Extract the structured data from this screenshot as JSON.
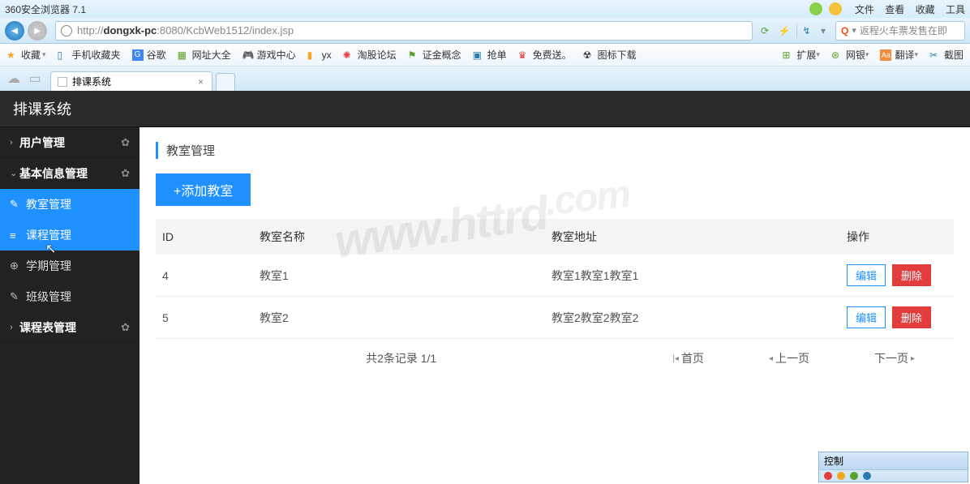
{
  "browser": {
    "title": "360安全浏览器 7.1",
    "menus": [
      "文件",
      "查看",
      "收藏",
      "工具"
    ],
    "url_prefix": "http://",
    "url_host": "dongxk-pc",
    "url_rest": ":8080/KcbWeb1512/index.jsp",
    "search_placeholder": "返程火车票发售在即",
    "bookmarks_left": [
      {
        "label": "收藏",
        "icon": "star"
      },
      {
        "label": "手机收藏夹",
        "icon": "phone"
      },
      {
        "label": "谷歌",
        "icon": "g"
      },
      {
        "label": "网址大全",
        "icon": "grid"
      },
      {
        "label": "游戏中心",
        "icon": "game"
      },
      {
        "label": "yx",
        "icon": "link"
      },
      {
        "label": "淘股论坛",
        "icon": "tao"
      },
      {
        "label": "证金概念",
        "icon": "flag"
      },
      {
        "label": "抢单",
        "icon": "bolt"
      },
      {
        "label": "免费送。",
        "icon": "gift"
      },
      {
        "label": "图标下载",
        "icon": "dl"
      }
    ],
    "bookmarks_right": [
      {
        "label": "扩展",
        "icon": "ext"
      },
      {
        "label": "网银",
        "icon": "bank"
      },
      {
        "label": "翻译",
        "icon": "trans"
      },
      {
        "label": "截图",
        "icon": "snip"
      }
    ],
    "tab_title": "排课系统",
    "control_panel": "控制"
  },
  "app": {
    "title": "排课系统",
    "sidebar": {
      "groups": [
        {
          "label": "用户管理",
          "chev": "›",
          "gear": true
        },
        {
          "label": "基本信息管理",
          "chev": "⌄",
          "gear": true,
          "items": [
            {
              "label": "教室管理",
              "icon": "✎",
              "state": "active"
            },
            {
              "label": "课程管理",
              "icon": "≡",
              "state": "current"
            },
            {
              "label": "学期管理",
              "icon": "⊕"
            },
            {
              "label": "班级管理",
              "icon": "✎"
            }
          ]
        },
        {
          "label": "课程表管理",
          "chev": "›",
          "gear": true
        }
      ]
    },
    "page": {
      "title": "教室管理",
      "add_button": "+添加教室",
      "columns": [
        "ID",
        "教室名称",
        "教室地址",
        "操作"
      ],
      "rows": [
        {
          "id": "4",
          "name": "教室1",
          "addr": "教室1教室1教室1"
        },
        {
          "id": "5",
          "name": "教室2",
          "addr": "教室2教室2教室2"
        }
      ],
      "edit_label": "编辑",
      "delete_label": "删除",
      "pager": {
        "info": "共2条记录 1/1",
        "first": "首页",
        "prev": "上一页",
        "next": "下一页"
      }
    }
  },
  "watermark": "www.httrd",
  "watermark2": ".com"
}
